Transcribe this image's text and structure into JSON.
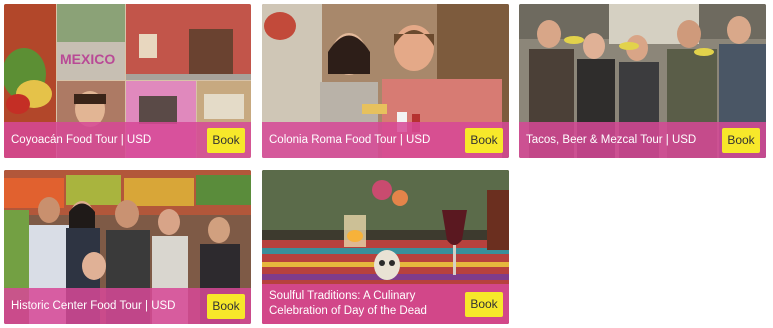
{
  "cards": [
    {
      "title": "Coyoacán Food Tour | USD",
      "button": "Book"
    },
    {
      "title": "Colonia Roma Food Tour | USD",
      "button": "Book"
    },
    {
      "title": "Tacos, Beer & Mezcal Tour | USD",
      "button": "Book"
    },
    {
      "title": "Historic Center Food Tour | USD",
      "button": "Book"
    },
    {
      "title": "Soulful Traditions: A Culinary Celebration of Day of the Dead",
      "button": "Book"
    }
  ],
  "photo_texts": {
    "coyoacan_sign": "MEXICO"
  },
  "colors": {
    "overlay": "#d64896",
    "button_bg": "#f7e82a",
    "button_text": "#333333"
  }
}
